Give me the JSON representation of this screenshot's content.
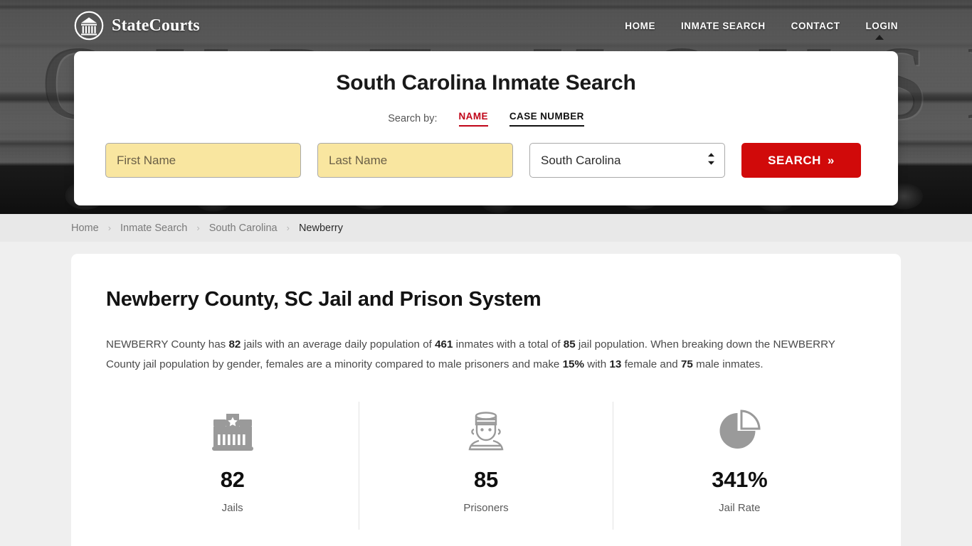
{
  "brand": {
    "name": "StateCourts",
    "logo_icon": "courthouse-circle-icon"
  },
  "nav": {
    "links": [
      {
        "label": "HOME"
      },
      {
        "label": "INMATE SEARCH"
      },
      {
        "label": "CONTACT"
      },
      {
        "label": "LOGIN"
      }
    ]
  },
  "hero": {
    "background_text": "COURT HOUSE",
    "background_color": "#4a4a4a"
  },
  "search": {
    "title": "South Carolina Inmate Search",
    "search_by_label": "Search by:",
    "tabs": [
      {
        "label": "NAME",
        "active": true
      },
      {
        "label": "CASE NUMBER",
        "active": false
      }
    ],
    "first_name": {
      "value": "",
      "placeholder": "First Name"
    },
    "last_name": {
      "value": "",
      "placeholder": "Last Name"
    },
    "state_select": {
      "selected": "South Carolina",
      "options": [
        "South Carolina"
      ]
    },
    "button": {
      "label": "SEARCH",
      "chevrons": "»"
    },
    "accent_color": "#c00418",
    "button_color": "#d10a0a",
    "autofill_color": "#f9e6a0"
  },
  "breadcrumb": {
    "separator": "›",
    "items": [
      {
        "label": "Home",
        "current": false
      },
      {
        "label": "Inmate Search",
        "current": false
      },
      {
        "label": "South Carolina",
        "current": false
      },
      {
        "label": "Newberry",
        "current": true
      }
    ]
  },
  "main": {
    "page_title": "Newberry County, SC Jail and Prison System",
    "intro": {
      "part1": "NEWBERRY County has ",
      "jails": "82",
      "part2": " jails with an average daily population of ",
      "avg_daily_population": "461",
      "part3": " inmates with a total of ",
      "total_jail_population": "85",
      "part4": " jail population. When breaking down the NEWBERRY County jail population by gender, females are a minority compared to male prisoners and make ",
      "female_percent": "15%",
      "part5": " with ",
      "female_count": "13",
      "part6": " female and ",
      "male_count": "75",
      "part7": " male inmates."
    },
    "stats": [
      {
        "icon": "jail-building-icon",
        "value": "82",
        "label": "Jails"
      },
      {
        "icon": "prisoner-icon",
        "value": "85",
        "label": "Prisoners"
      },
      {
        "icon": "pie-chart-icon",
        "value": "341%",
        "label": "Jail Rate"
      }
    ]
  }
}
